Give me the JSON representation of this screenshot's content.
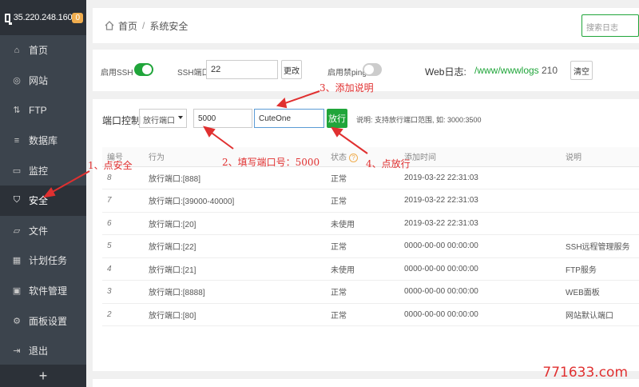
{
  "sidebar": {
    "ip": "35.220.248.160",
    "badge": "0",
    "items": [
      {
        "label": "首页",
        "icon": "home-icon"
      },
      {
        "label": "网站",
        "icon": "globe-icon"
      },
      {
        "label": "FTP",
        "icon": "ftp-icon"
      },
      {
        "label": "数据库",
        "icon": "database-icon"
      },
      {
        "label": "监控",
        "icon": "monitor-icon"
      },
      {
        "label": "安全",
        "icon": "shield-icon"
      },
      {
        "label": "文件",
        "icon": "folder-icon"
      },
      {
        "label": "计划任务",
        "icon": "calendar-icon"
      },
      {
        "label": "软件管理",
        "icon": "apps-icon"
      },
      {
        "label": "面板设置",
        "icon": "gear-icon"
      },
      {
        "label": "退出",
        "icon": "logout-icon"
      }
    ],
    "active_index": 5,
    "add_label": "+"
  },
  "breadcrumb": {
    "home": "首页",
    "current": "系统安全",
    "search_placeholder": "搜索日志"
  },
  "ssh": {
    "enable_label": "启用SSH",
    "enabled": true,
    "port_label": "SSH端口:",
    "port_value": "22",
    "change_button": "更改",
    "ping_label": "启用禁ping",
    "ping_enabled": false,
    "weblog_label": "Web日志:",
    "weblog_path": "/www/wwwlogs",
    "weblog_size": "210",
    "clear_button": "清空"
  },
  "port_control": {
    "title": "端口控制",
    "select_value": "放行端口",
    "port_input": "5000",
    "desc_input": "CuteOne",
    "allow_button": "放行",
    "hint": "说明: 支持放行端口范围, 如: 3000:3500"
  },
  "table": {
    "headers": [
      "编号",
      "行为",
      "状态",
      "添加时间",
      "说明"
    ],
    "rows": [
      [
        "8",
        "放行端口:[888]",
        "正常",
        "2019-03-22 22:31:03",
        ""
      ],
      [
        "7",
        "放行端口:[39000-40000]",
        "正常",
        "2019-03-22 22:31:03",
        ""
      ],
      [
        "6",
        "放行端口:[20]",
        "未使用",
        "2019-03-22 22:31:03",
        ""
      ],
      [
        "5",
        "放行端口:[22]",
        "正常",
        "0000-00-00 00:00:00",
        "SSH远程管理服务"
      ],
      [
        "4",
        "放行端口:[21]",
        "未使用",
        "0000-00-00 00:00:00",
        "FTP服务"
      ],
      [
        "3",
        "放行端口:[8888]",
        "正常",
        "0000-00-00 00:00:00",
        "WEB面板"
      ],
      [
        "2",
        "放行端口:[80]",
        "正常",
        "0000-00-00 00:00:00",
        "网站默认端口"
      ]
    ]
  },
  "annotations": {
    "step1": "1、点安全",
    "step2": "2、填写端口号：5000",
    "step3": "3、添加说明",
    "step4": "4、点放行"
  },
  "watermark": "771633.com",
  "colors": {
    "accent": "#20a53a",
    "annotation": "#e03030",
    "sidebar": "#3c444d"
  }
}
